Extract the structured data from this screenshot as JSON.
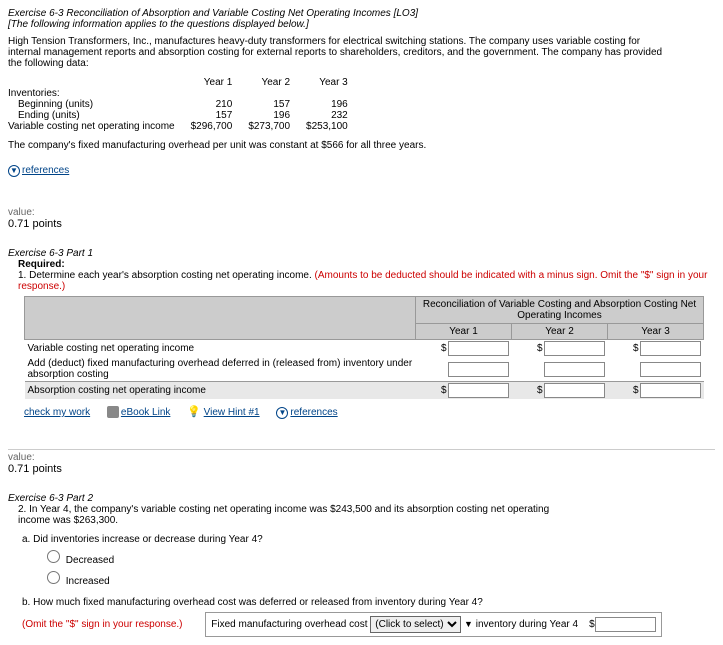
{
  "header": {
    "title": "Exercise 6-3 Reconciliation of Absorption and Variable Costing Net Operating Incomes [LO3]",
    "subtitle": "[The following information applies to the questions displayed below.]",
    "intro": "High Tension Transformers, Inc., manufactures heavy-duty transformers for electrical switching stations. The company uses variable costing for internal management reports and absorption costing for external reports to shareholders, creditors, and the government. The company has provided the following data:"
  },
  "data_table": {
    "col_headers": [
      "",
      "Year 1",
      "Year 2",
      "Year 3"
    ],
    "rows": [
      {
        "label": "Inventories:",
        "v": [
          "",
          "",
          ""
        ]
      },
      {
        "label": "Beginning (units)",
        "indent": true,
        "v": [
          "210",
          "157",
          "196"
        ]
      },
      {
        "label": "Ending (units)",
        "indent": true,
        "v": [
          "157",
          "196",
          "232"
        ]
      },
      {
        "label": "Variable costing net operating income",
        "v": [
          "$296,700",
          "$273,700",
          "$253,100"
        ]
      }
    ],
    "note": "The company's fixed manufacturing overhead per unit was constant at $566 for all three years."
  },
  "references_link": "references",
  "value_label": "value:",
  "points": "0.71 points",
  "part1": {
    "heading": "Exercise 6-3 Part 1",
    "req_label": "Required:",
    "q": "1.  Determine each year's absorption costing net operating income.",
    "q_red": " (Amounts to be deducted should be indicated with a minus sign. Omit the \"$\" sign in your response.)",
    "table": {
      "title": "Reconciliation of Variable Costing and Absorption Costing Net Operating Incomes",
      "years": [
        "Year 1",
        "Year 2",
        "Year 3"
      ],
      "row1": "Variable costing net operating income",
      "row2": "Add (deduct) fixed manufacturing overhead deferred in (released from) inventory under absorption costing",
      "row3": "Absorption costing net operating income"
    }
  },
  "toolbar": {
    "check": "check my work",
    "ebook": "eBook Link",
    "hint": "View Hint #1",
    "refs": "references"
  },
  "part2": {
    "heading": "Exercise 6-3 Part 2",
    "q2": "2.  In Year 4, the company's variable costing net operating income was $243,500 and its absorption costing net operating income was $263,300.",
    "qa": "a.  Did inventories increase or decrease during Year 4?",
    "opt_dec": "Decreased",
    "opt_inc": "Increased",
    "qb": "b.  How much fixed manufacturing overhead cost was deferred or released from inventory during Year 4?",
    "qb_red": "(Omit the \"$\" sign in your response.)",
    "answer_prefix": "Fixed manufacturing overhead cost",
    "dropdown_placeholder": "(Click to select)",
    "answer_suffix": "inventory during Year 4"
  }
}
